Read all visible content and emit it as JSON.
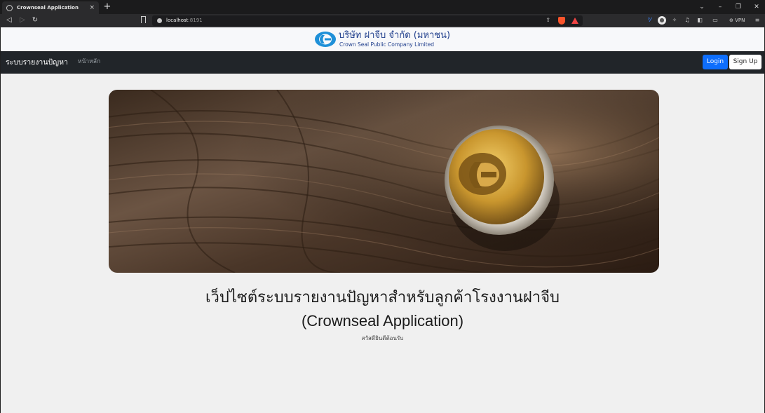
{
  "browser": {
    "tab_title": "Crownseal Application",
    "tab_close": "×",
    "new_tab": "+",
    "url_host": "localhost",
    "url_port": ":8191",
    "vpn_label": "VPN",
    "window_controls": [
      "⌄",
      "–",
      "❐",
      "✕"
    ]
  },
  "brand": {
    "company_th": "บริษัท ฝาจีบ จำกัด (มหาชน)",
    "company_en": "Crown Seal Public Company Limited",
    "logo_color": "#1e90d8"
  },
  "navbar": {
    "brand": "ระบบรายงานปัญหา",
    "home_link": "หน้าหลัก",
    "login_label": "Login",
    "signup_label": "Sign Up"
  },
  "hero": {
    "headline_th": "เว็ปไซต์ระบบรายงานปัญหาสำหรับลูกค้าโรงงานฝาจีบ",
    "headline_en": "(Crownseal Application)",
    "welcome": "สวัสดียินดีต้อนรับ"
  },
  "colors": {
    "navbar_bg": "#212529",
    "primary": "#0d6efd",
    "page_bg": "#f0f0f0"
  }
}
